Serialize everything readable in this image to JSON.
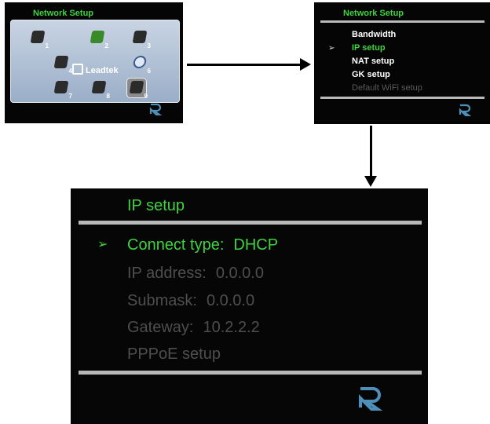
{
  "screen1": {
    "title": "Network Setup",
    "brand": "Leadtek",
    "tiles": [
      "1",
      "2",
      "3",
      "4",
      "5",
      "6",
      "7",
      "8",
      "9"
    ],
    "selected_tile": "9"
  },
  "screen2": {
    "title": "Network Setup",
    "items": [
      "Bandwidth",
      "IP setup",
      "NAT setup",
      "GK setup",
      "Default WiFi setup"
    ],
    "selected_item": "IP setup",
    "cursor": "➢"
  },
  "screen3": {
    "title": "IP setup",
    "cursor": "➢",
    "rows": [
      {
        "label": "Connect type:",
        "value": "DHCP"
      },
      {
        "label": "IP address:",
        "value": "0.0.0.0"
      },
      {
        "label": "Submask:",
        "value": "0.0.0.0"
      },
      {
        "label": "Gateway:",
        "value": "10.2.2.2"
      },
      {
        "label": "PPPoE setup",
        "value": ""
      }
    ]
  },
  "colors": {
    "accent_green": "#3fd33f",
    "screen_bg": "#050505",
    "disabled": "#4e4e4e",
    "logo_blue": "#4d8fb8"
  },
  "icons": {
    "logo": "leadtek-r-logo-icon",
    "cursor": "arrow-cursor-icon"
  }
}
